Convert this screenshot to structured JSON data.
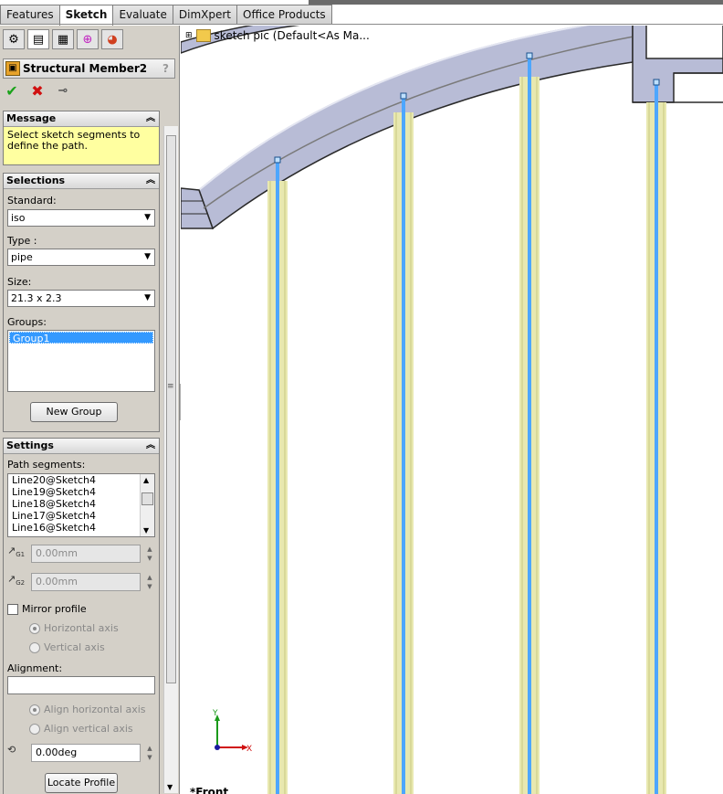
{
  "command_tabs": [
    "Features",
    "Sketch",
    "Evaluate",
    "DimXpert",
    "Office Products"
  ],
  "active_tab": "Sketch",
  "panel_tabs": [
    "feature-manager-icon",
    "property-manager-icon",
    "configuration-manager-icon",
    "dimxpert-manager-icon",
    "display-manager-icon"
  ],
  "property_manager": {
    "title": "Structural Member2",
    "help": "?",
    "ok": "✔",
    "cancel": "✖",
    "pin": "⊸"
  },
  "message": {
    "header": "Message",
    "text": "Select sketch segments to define the path."
  },
  "selections": {
    "header": "Selections",
    "standard_label": "Standard:",
    "standard_value": "iso",
    "type_label": "Type :",
    "type_value": "pipe",
    "size_label": "Size:",
    "size_value": "21.3 x 2.3",
    "groups_label": "Groups:",
    "groups": [
      "Group1"
    ],
    "new_group_button": "New Group"
  },
  "settings": {
    "header": "Settings",
    "path_segments_label": "Path segments:",
    "path_segments": [
      "Line20@Sketch4",
      "Line19@Sketch4",
      "Line18@Sketch4",
      "Line17@Sketch4",
      "Line16@Sketch4"
    ],
    "gap1_value": "0.00mm",
    "gap2_value": "0.00mm",
    "mirror_profile_label": "Mirror profile",
    "horizontal_axis_label": "Horizontal axis",
    "vertical_axis_label": "Vertical axis",
    "alignment_label": "Alignment:",
    "alignment_value": "",
    "align_horizontal_label": "Align horizontal axis",
    "align_vertical_label": "Align vertical axis",
    "rotation_value": "0.00deg",
    "locate_profile_button": "Locate Profile"
  },
  "viewport": {
    "tree_node": "sketch pic  (Default<As Ma...",
    "view_name": "*Front",
    "triad_x": "X",
    "triad_y": "Y"
  },
  "colors": {
    "frame_face": "#b8bcd6",
    "frame_edge": "#2a2a2a",
    "selected_line": "#4da6ff",
    "pipe_fill": "#e8e8b0",
    "message_bg": "#ffffa0"
  }
}
